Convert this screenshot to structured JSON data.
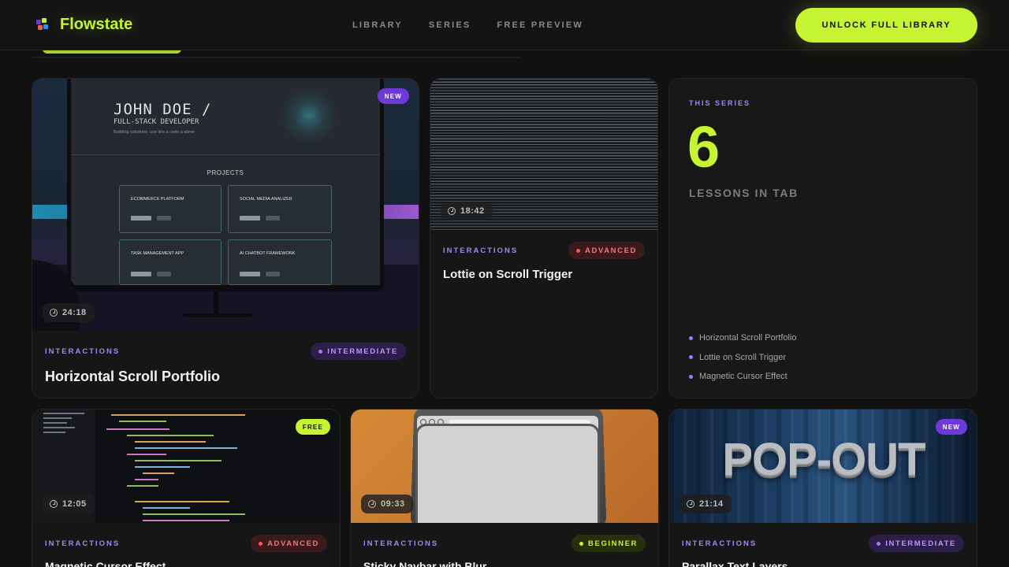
{
  "header": {
    "brand": "Flowstate",
    "nav": [
      "LIBRARY",
      "SERIES",
      "FREE PREVIEW"
    ],
    "cta": "UNLOCK FULL LIBRARY"
  },
  "colors": {
    "accent": "#c6f432",
    "purple": "#6d3ad9",
    "background": "#111111"
  },
  "cards": [
    {
      "category": "INTERACTIONS",
      "level": "INTERMEDIATE",
      "title": "Horizontal Scroll Portfolio",
      "duration": "24:18",
      "badge": "NEW",
      "thumb": {
        "name": "JOHN DOE /",
        "role": "FULL-STACK DEVELOPER",
        "tagline": "Building solutions, one line a code a atime",
        "section": "PROJECTS",
        "projects": [
          "ECOMMERCE PLATFORM",
          "SOCIAL MEDIA ANALIZER",
          "TASK MANAGEMENT APP",
          "AI CHATBOT FRAMEWORK"
        ]
      }
    },
    {
      "category": "INTERACTIONS",
      "level": "ADVANCED",
      "title": "Lottie on Scroll Trigger",
      "duration": "18:42"
    },
    {
      "category": "INTERACTIONS",
      "level": "ADVANCED",
      "title": "Magnetic Cursor Effect",
      "duration": "12:05",
      "badge": "FREE"
    },
    {
      "category": "INTERACTIONS",
      "level": "BEGINNER",
      "title": "Sticky Navbar with Blur",
      "duration": "09:33"
    },
    {
      "category": "INTERACTIONS",
      "level": "INTERMEDIATE",
      "title": "Parallax Text Layers",
      "duration": "21:14",
      "badge": "NEW",
      "thumb_text": "POP-OUT"
    }
  ],
  "series": {
    "eyebrow": "THIS SERIES",
    "count": "6",
    "subtitle": "LESSONS IN TAB",
    "items": [
      "Horizontal Scroll Portfolio",
      "Lottie on Scroll Trigger",
      "Magnetic Cursor Effect"
    ]
  }
}
